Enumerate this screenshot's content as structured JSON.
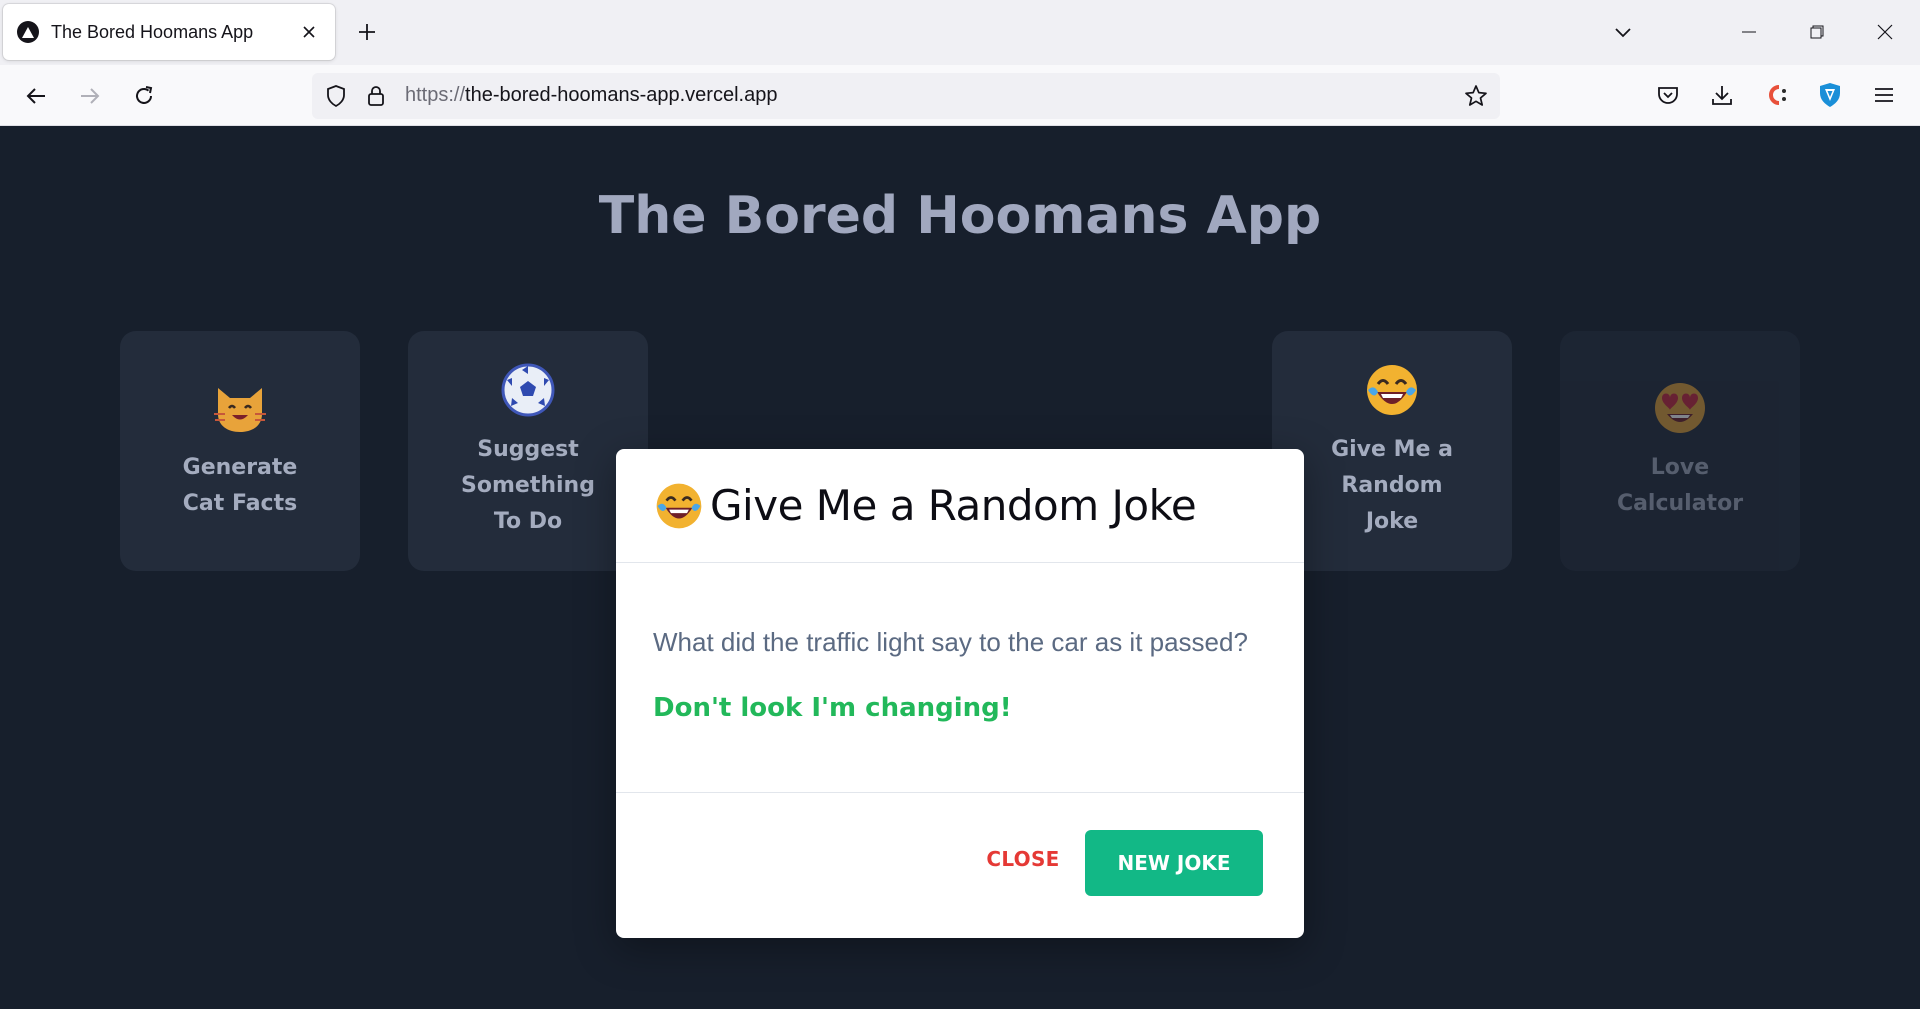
{
  "browser": {
    "tab_title": "The Bored Hoomans App",
    "url_scheme": "https://",
    "url_host": "the-bored-hoomans-app.vercel.app"
  },
  "app": {
    "title": "The Bored Hoomans App",
    "cards": [
      {
        "label": "Generate\nCat Facts",
        "icon": "cat-face-emoji"
      },
      {
        "label": "Suggest\nSomething\nTo Do",
        "icon": "soccer-ball-emoji"
      },
      {
        "label": "",
        "icon": "hidden-card"
      },
      {
        "label": "",
        "icon": "hidden-card"
      },
      {
        "label": "Give Me a\nRandom\nJoke",
        "icon": "tears-of-joy-emoji"
      },
      {
        "label": "Love\nCalculator",
        "icon": "heart-eyes-emoji"
      }
    ]
  },
  "modal": {
    "title": "Give Me a Random Joke",
    "icon": "tears-of-joy-emoji",
    "joke_setup": "What did the traffic light say to the car as it passed?",
    "joke_punchline": "Don't look I'm changing!",
    "close_label": "CLOSE",
    "new_joke_label": "NEW JOKE"
  },
  "colors": {
    "page_bg": "#171f2c",
    "card_bg": "#232c3b",
    "punchline": "#22b85a",
    "close": "#e53935",
    "primary_button": "#12b886"
  }
}
